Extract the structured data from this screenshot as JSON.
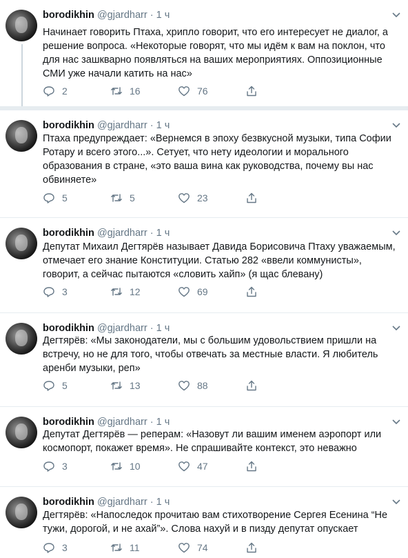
{
  "tweets": [
    {
      "name": "borodikhin",
      "handle": "@gjardharr",
      "time": "1 ч",
      "text": "Начинает говорить Птаха, хрипло говорит, что его интересует не диалог, а решение вопроса. «Некоторые говорят, что мы идём к вам на поклон, что для нас зашкварно появляться на ваших мероприятиях. Оппозиционные СМИ уже начали катить на нас»",
      "replies": "2",
      "retweets": "16",
      "likes": "76"
    },
    {
      "name": "borodikhin",
      "handle": "@gjardharr",
      "time": "1 ч",
      "text": "Птаха предупреждает: «Вернемся в эпоху безвкусной музыки, типа Софии Ротару и всего этого...». Сетует, что нету идеологии и морального образования в стране, «это ваша вина как руководства, почему вы нас обвиняете»",
      "replies": "5",
      "retweets": "5",
      "likes": "23"
    },
    {
      "name": "borodikhin",
      "handle": "@gjardharr",
      "time": "1 ч",
      "text": "Депутат Михаил Дегтярёв называет Давида Борисовича Птаху уважаемым, отмечает его знание Конституции. Статью 282 «ввели коммунисты», говорит, а сейчас пытаются «словить хайп» (я щас блевану)",
      "replies": "3",
      "retweets": "12",
      "likes": "69"
    },
    {
      "name": "borodikhin",
      "handle": "@gjardharr",
      "time": "1 ч",
      "text": "Дегтярёв: «Мы законодатели, мы с большим удовольствием пришли на встречу, но не для того, чтобы отвечать за местные власти. Я любитель аренби музыки, реп»",
      "replies": "5",
      "retweets": "13",
      "likes": "88"
    },
    {
      "name": "borodikhin",
      "handle": "@gjardharr",
      "time": "1 ч",
      "text": "Депутат Дегтярёв — реперам: «Назовут ли вашим именем аэропорт или космопорт, покажет время». Не спрашивайте контекст, это неважно",
      "replies": "3",
      "retweets": "10",
      "likes": "47"
    },
    {
      "name": "borodikhin",
      "handle": "@gjardharr",
      "time": "1 ч",
      "text": "Дегтярёв: «Напоследок прочитаю вам стихотворение Сергея Есенина “Не тужи, дорогой, и не ахай”». Слова нахуй и в пизду депутат опускает",
      "replies": "3",
      "retweets": "11",
      "likes": "74"
    }
  ],
  "icons": {
    "reply": "reply-icon",
    "retweet": "retweet-icon",
    "like": "heart-icon",
    "share": "share-icon",
    "menu": "chevron-down-icon"
  },
  "colors": {
    "muted": "#657786",
    "text": "#14171a",
    "divider": "#e6ecf0"
  }
}
